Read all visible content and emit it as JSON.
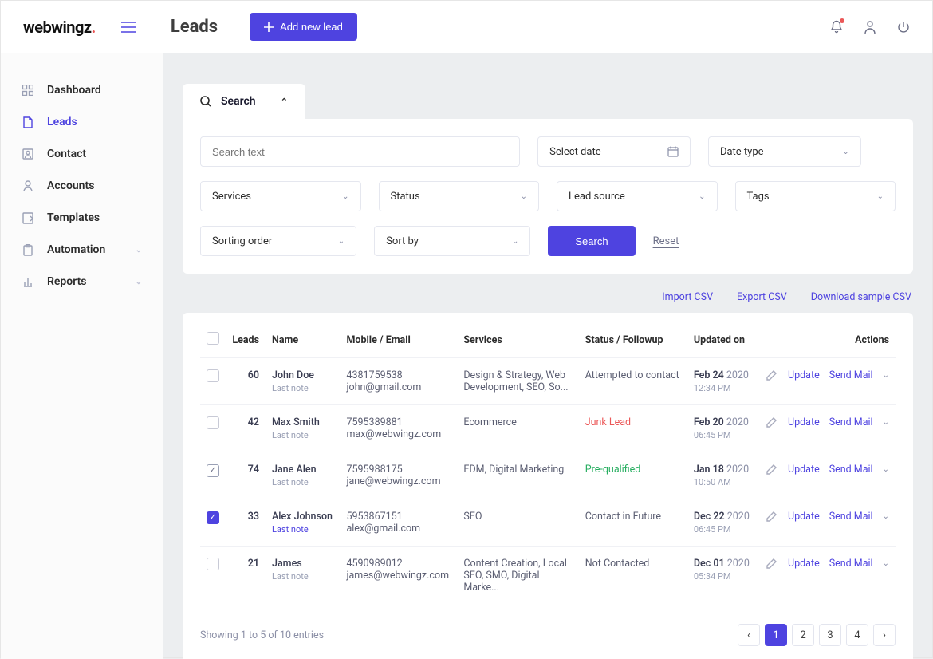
{
  "brand": {
    "part1": "web",
    "part2": "wingz",
    "dot": "."
  },
  "header": {
    "title": "Leads",
    "add_button": "Add new lead"
  },
  "sidebar": {
    "items": [
      {
        "label": "Dashboard"
      },
      {
        "label": "Leads"
      },
      {
        "label": "Contact"
      },
      {
        "label": "Accounts"
      },
      {
        "label": "Templates"
      },
      {
        "label": "Automation"
      },
      {
        "label": "Reports"
      }
    ]
  },
  "search": {
    "title": "Search",
    "text_placeholder": "Search text",
    "date_placeholder": "Select date",
    "date_type": "Date type",
    "services": "Services",
    "status": "Status",
    "lead_source": "Lead source",
    "tags": "Tags",
    "sorting_order": "Sorting order",
    "sort_by": "Sort by",
    "search_btn": "Search",
    "reset": "Reset"
  },
  "csv": {
    "import": "Import CSV",
    "export": "Export CSV",
    "download": "Download sample CSV"
  },
  "table": {
    "headers": {
      "leads": "Leads",
      "name": "Name",
      "mobile_email": "Mobile / Email",
      "services": "Services",
      "status": "Status / Followup",
      "updated": "Updated on",
      "actions": "Actions"
    },
    "last_note": "Last note",
    "row_actions": {
      "update": "Update",
      "send_mail": "Send Mail"
    },
    "rows": [
      {
        "id": "60",
        "name": "John Doe",
        "mobile": "4381759538",
        "email": "john@gmail.com",
        "services": "Design & Strategy, Web Development, SEO, So...",
        "status": "Attempted to contact",
        "status_color": "",
        "date_strong": "Feb 24",
        "year": "2020",
        "time": "12:34 PM",
        "note_link": false,
        "checked": ""
      },
      {
        "id": "42",
        "name": "Max Smith",
        "mobile": "7595389881",
        "email": "max@webwingz.com",
        "services": "Ecommerce",
        "status": "Junk Lead",
        "status_color": "red",
        "date_strong": "Feb 20",
        "year": "2020",
        "time": "06:45 PM",
        "note_link": false,
        "checked": ""
      },
      {
        "id": "74",
        "name": "Jane Alen",
        "mobile": "7595988175",
        "email": "jane@webwingz.com",
        "services": "EDM, Digital Marketing",
        "status": "Pre-qualified",
        "status_color": "green",
        "date_strong": "Jan 18",
        "year": "2020",
        "time": "10:50 AM",
        "note_link": false,
        "checked": "outline"
      },
      {
        "id": "33",
        "name": "Alex Johnson",
        "mobile": "5953867151",
        "email": "alex@gmail.com",
        "services": "SEO",
        "status": "Contact in Future",
        "status_color": "",
        "date_strong": "Dec 22",
        "year": "2020",
        "time": "06:45 PM",
        "note_link": true,
        "checked": "yes"
      },
      {
        "id": "21",
        "name": "James",
        "mobile": "4590989012",
        "email": "james@webwingz.com",
        "services": "Content Creation, Local SEO, SMO, Digital Marke...",
        "status": "Not Contacted",
        "status_color": "",
        "date_strong": "Dec 01",
        "year": "2020",
        "time": "05:34 PM",
        "note_link": false,
        "checked": ""
      }
    ],
    "footer": "Showing 1 to 5 of 10 entries",
    "pages": [
      "1",
      "2",
      "3",
      "4"
    ]
  }
}
